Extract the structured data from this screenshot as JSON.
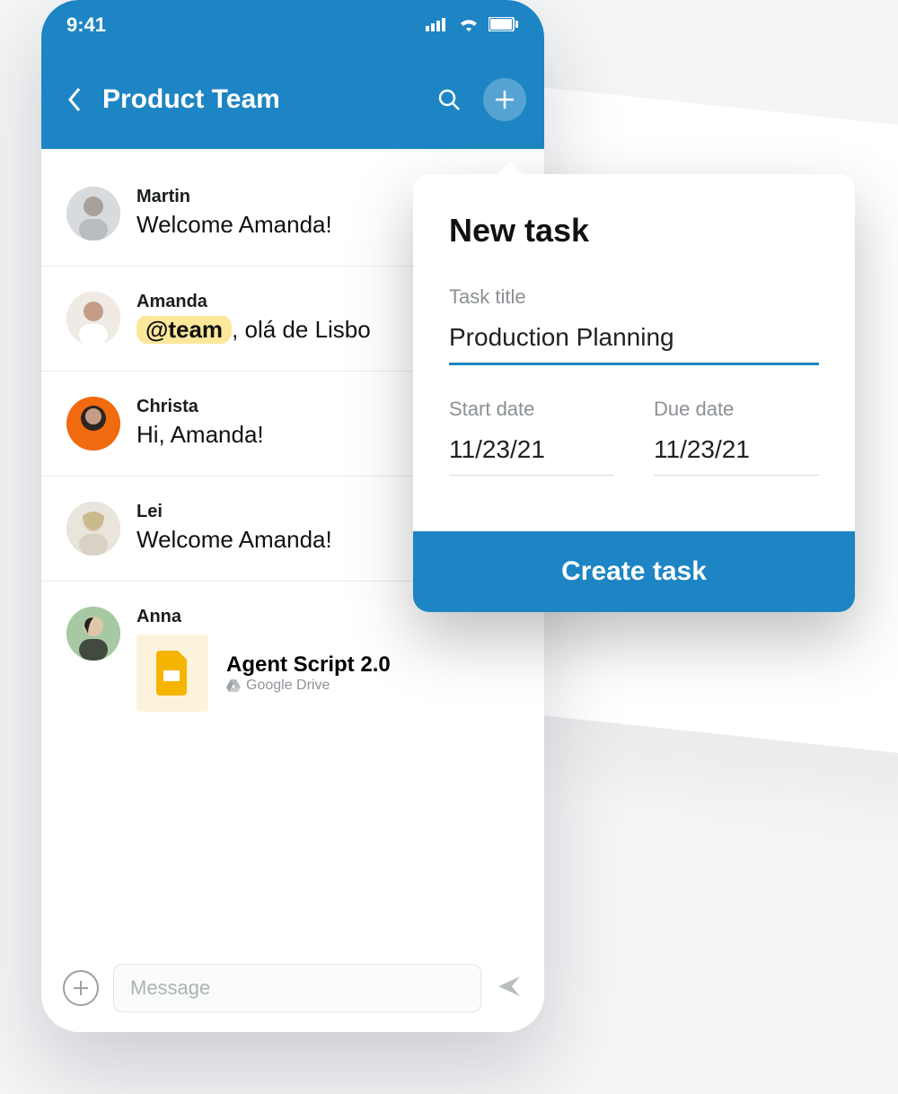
{
  "statusbar": {
    "time": "9:41"
  },
  "navbar": {
    "title": "Product Team"
  },
  "messages": [
    {
      "name": "Martin",
      "text": "Welcome Amanda!",
      "mention": null
    },
    {
      "name": "Amanda",
      "mention": "@team",
      "text": ", olá de Lisbo"
    },
    {
      "name": "Christa",
      "text": "Hi, Amanda!",
      "mention": null
    },
    {
      "name": "Lei",
      "text": "Welcome Amanda!",
      "mention": null
    },
    {
      "name": "Anna",
      "file": {
        "title": "Agent Script 2.0",
        "source": "Google Drive"
      }
    }
  ],
  "composer": {
    "placeholder": "Message"
  },
  "popover": {
    "title": "New task",
    "task_title_label": "Task title",
    "task_title_value": "Production Planning",
    "start_label": "Start date",
    "start_value": "11/23/21",
    "due_label": "Due date",
    "due_value": "11/23/21",
    "create_label": "Create task"
  }
}
